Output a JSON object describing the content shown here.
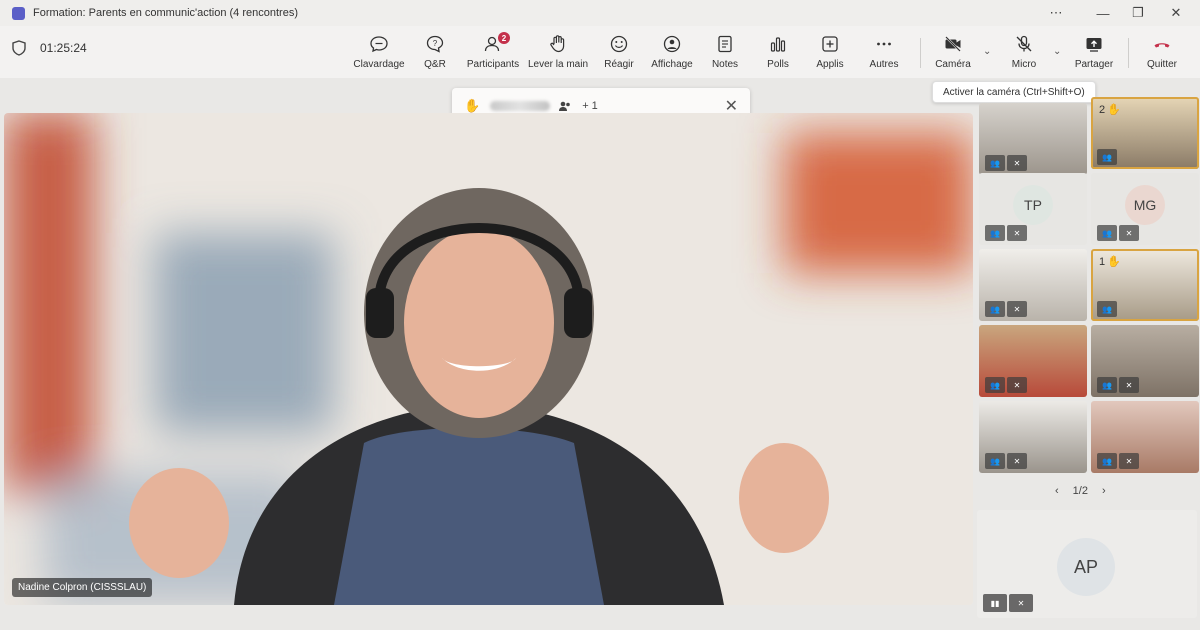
{
  "window": {
    "title": "Formation: Parents en communic'action (4 rencontres)",
    "controls": [
      "⋯",
      "—",
      "❐",
      "✕"
    ]
  },
  "meeting": {
    "elapsed": "01:25:24"
  },
  "toolbar": {
    "chat": "Clavardage",
    "qa": "Q&R",
    "participants": "Participants",
    "participants_badge": "2",
    "raise_hand": "Lever la main",
    "react": "Réagir",
    "view": "Affichage",
    "notes": "Notes",
    "polls": "Polls",
    "apps": "Applis",
    "more": "Autres",
    "camera": "Caméra",
    "mic": "Micro",
    "share": "Partager",
    "leave": "Quitter"
  },
  "tooltip": {
    "camera": "Activer la caméra (Ctrl+Shift+O)"
  },
  "raised_hands": {
    "extra_count": "+ 1"
  },
  "main_video": {
    "speaker_name": "Nadine Colpron (CISSSLAU)"
  },
  "gallery": {
    "tiles": [
      {
        "initials": "",
        "raised_hand_order": ""
      },
      {
        "initials": "",
        "raised_hand_order": "2"
      },
      {
        "initials": "TP",
        "raised_hand_order": ""
      },
      {
        "initials": "MG",
        "raised_hand_order": ""
      },
      {
        "initials": "",
        "raised_hand_order": ""
      },
      {
        "initials": "",
        "raised_hand_order": "1"
      },
      {
        "initials": "",
        "raised_hand_order": ""
      },
      {
        "initials": "",
        "raised_hand_order": ""
      },
      {
        "initials": "",
        "raised_hand_order": ""
      },
      {
        "initials": "",
        "raised_hand_order": ""
      }
    ],
    "page_indicator": "1/2",
    "self_tile_initials": "AP"
  },
  "colors": {
    "accent": "#5b5fc7",
    "leave_red": "#c4314b",
    "raised_hand": "#e3a22b"
  }
}
